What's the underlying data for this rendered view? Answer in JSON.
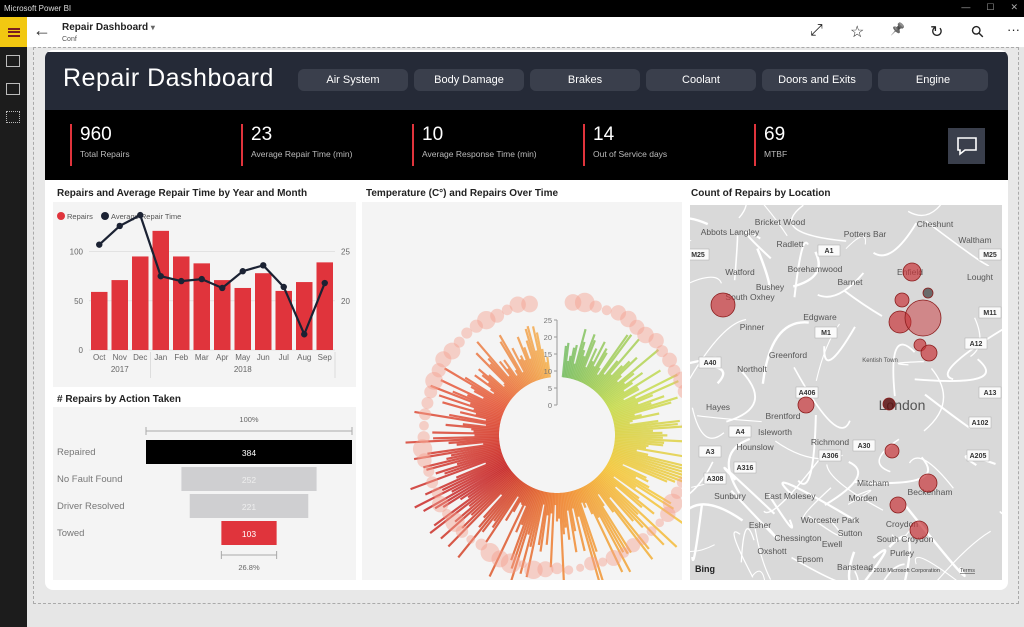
{
  "window": {
    "title": "Microsoft Power BI"
  },
  "appbar": {
    "title": "Repair  Dashboard",
    "subtitle": "Conf",
    "chevron": "▾",
    "back_icon": "arrow-left-icon",
    "tools": [
      {
        "name": "fullscreen",
        "glyph": "⤢"
      },
      {
        "name": "favorite",
        "glyph": "☆"
      },
      {
        "name": "pin",
        "glyph": "📌"
      },
      {
        "name": "refresh",
        "glyph": "↻"
      },
      {
        "name": "search",
        "glyph": "⚲"
      },
      {
        "name": "more",
        "glyph": "···"
      }
    ]
  },
  "dashboard": {
    "title": "Repair Dashboard",
    "nav": [
      "Air System",
      "Body Damage",
      "Brakes",
      "Coolant",
      "Doors and Exits",
      "Engine"
    ],
    "kpis": [
      {
        "value": "960",
        "label": "Total Repairs"
      },
      {
        "value": "23",
        "label": "Average Repair Time (min)"
      },
      {
        "value": "10",
        "label": "Average Response Time (min)"
      },
      {
        "value": "14",
        "label": "Out of Service days"
      },
      {
        "value": "69",
        "label": "MTBF"
      }
    ]
  },
  "colors": {
    "accent": "#e0343c",
    "navy": "#252a37",
    "line": "#1b2233"
  },
  "chart_data": [
    {
      "type": "bar",
      "title": "Repairs and Average Repair Time by Year and Month",
      "categories": [
        "Oct",
        "Nov",
        "Dec",
        "Jan",
        "Feb",
        "Mar",
        "Apr",
        "May",
        "Jun",
        "Jul",
        "Aug",
        "Sep"
      ],
      "years": [
        {
          "label": "2017",
          "span": 3
        },
        {
          "label": "2018",
          "span": 9
        }
      ],
      "series": [
        {
          "name": "Repairs",
          "type": "bar",
          "axis": "left",
          "values": [
            59,
            71,
            95,
            121,
            95,
            88,
            71,
            63,
            78,
            60,
            69,
            89
          ]
        },
        {
          "name": "Average Repair Time",
          "type": "line",
          "axis": "right",
          "values": [
            25.7,
            27.6,
            28.7,
            22.5,
            22.0,
            22.2,
            21.3,
            23.0,
            23.6,
            21.4,
            16.6,
            21.8
          ]
        }
      ],
      "yleft": {
        "ticks": [
          "0",
          "50",
          "100"
        ],
        "lim": [
          0,
          130
        ]
      },
      "yright": {
        "ticks": [
          "20",
          "25"
        ],
        "lim": [
          15,
          28
        ]
      },
      "grid": true,
      "legend": "top-left"
    },
    {
      "type": "radial",
      "title": "Temperature (C°) and Repairs Over Time",
      "axis_ticks": [
        "0",
        "5",
        "10",
        "15",
        "20",
        "25"
      ]
    },
    {
      "type": "funnel",
      "title": "# Repairs by Action Taken",
      "top_label": "100%",
      "bottom_label": "26.8%",
      "categories": [
        "Repaired",
        "No Fault Found",
        "Driver Resolved",
        "Towed"
      ],
      "values": [
        384,
        252,
        221,
        103
      ]
    }
  ],
  "map": {
    "title": "Count of Repairs by Location",
    "attribution": "© 2018 Microsoft Corporation",
    "terms": "Terms",
    "provider": "Bing",
    "places": [
      "Bricket Wood",
      "Cheshunt",
      "Abbots Langley",
      "Potters Bar",
      "Radlett",
      "Waltham",
      "Watford",
      "Borehamwood",
      "Enfield",
      "Barnet",
      "Bushey",
      "South Oxhey",
      "Lought",
      "Edgware",
      "Pinner",
      "Greenford",
      "Northolt",
      "Kentish Town",
      "Hayes",
      "Brentford",
      "London",
      "Isleworth",
      "Hounslow",
      "Richmond",
      "Mitcham",
      "Beckenham",
      "Sunbury",
      "East Molesey",
      "Morden",
      "Worcester Park",
      "Esher",
      "Sutton",
      "Croydon",
      "Chessington",
      "Ewell",
      "South Croydon",
      "Purley",
      "Oxshott",
      "Epsom",
      "Banstead"
    ],
    "roads": [
      "M25",
      "A1",
      "M25",
      "M11",
      "M1",
      "A12",
      "A40",
      "A406",
      "A13",
      "A4",
      "A102",
      "A30",
      "A3",
      "A306",
      "A205",
      "A316",
      "A308"
    ]
  }
}
